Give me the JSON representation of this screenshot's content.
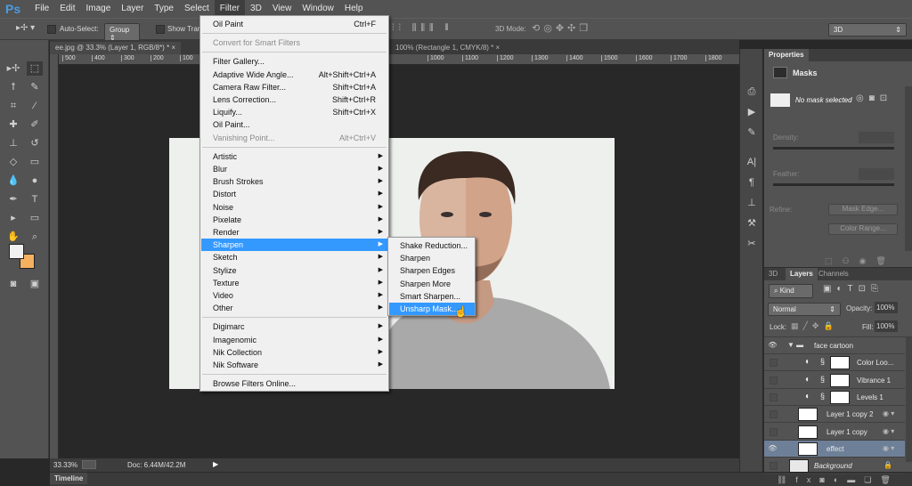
{
  "app": {
    "logo": "Ps"
  },
  "menubar": [
    "File",
    "Edit",
    "Image",
    "Layer",
    "Type",
    "Select",
    "Filter",
    "3D",
    "View",
    "Window",
    "Help"
  ],
  "options": {
    "auto_select": "Auto-Select:",
    "group": "Group",
    "show_transform": "Show Tran",
    "mode_label": "3D Mode:",
    "workspace": "3D"
  },
  "tabs": [
    {
      "label": "ee.jpg @ 33.3% (Layer 1, RGB/8*) *",
      "close": "×"
    },
    {
      "label": "100% (Rectangle 1, CMYK/8) *",
      "close": "×"
    }
  ],
  "ruler": [
    "500",
    "400",
    "300",
    "200",
    "100",
    "0",
    "1000",
    "1100",
    "1200",
    "1300",
    "1400",
    "1500",
    "1600",
    "1700",
    "1800",
    "1900",
    "2000",
    "2100",
    "2200",
    "2300",
    "2400"
  ],
  "status": {
    "zoom": "33.33%",
    "doc": "Doc: 6.44M/42.2M"
  },
  "timeline": "Timeline",
  "filter_menu": [
    {
      "label": "Oil Paint",
      "shortcut": "Ctrl+F"
    },
    {
      "sep": true
    },
    {
      "label": "Convert for Smart Filters",
      "disabled": true
    },
    {
      "sep": true
    },
    {
      "label": "Filter Gallery..."
    },
    {
      "label": "Adaptive Wide Angle...",
      "shortcut": "Alt+Shift+Ctrl+A"
    },
    {
      "label": "Camera Raw Filter...",
      "shortcut": "Shift+Ctrl+A"
    },
    {
      "label": "Lens Correction...",
      "shortcut": "Shift+Ctrl+R"
    },
    {
      "label": "Liquify...",
      "shortcut": "Shift+Ctrl+X"
    },
    {
      "label": "Oil Paint..."
    },
    {
      "label": "Vanishing Point...",
      "shortcut": "Alt+Ctrl+V",
      "disabled": true
    },
    {
      "sep": true
    },
    {
      "label": "Artistic",
      "sub": true
    },
    {
      "label": "Blur",
      "sub": true
    },
    {
      "label": "Brush Strokes",
      "sub": true
    },
    {
      "label": "Distort",
      "sub": true
    },
    {
      "label": "Noise",
      "sub": true
    },
    {
      "label": "Pixelate",
      "sub": true
    },
    {
      "label": "Render",
      "sub": true
    },
    {
      "label": "Sharpen",
      "sub": true,
      "highlighted": true
    },
    {
      "label": "Sketch",
      "sub": true
    },
    {
      "label": "Stylize",
      "sub": true
    },
    {
      "label": "Texture",
      "sub": true
    },
    {
      "label": "Video",
      "sub": true
    },
    {
      "label": "Other",
      "sub": true
    },
    {
      "sep": true
    },
    {
      "label": "Digimarc",
      "sub": true
    },
    {
      "label": "Imagenomic",
      "sub": true
    },
    {
      "label": "Nik Collection",
      "sub": true
    },
    {
      "label": "Nik Software",
      "sub": true
    },
    {
      "sep": true
    },
    {
      "label": "Browse Filters Online..."
    }
  ],
  "sharpen_menu": [
    {
      "label": "Shake Reduction..."
    },
    {
      "label": "Sharpen"
    },
    {
      "label": "Sharpen Edges"
    },
    {
      "label": "Sharpen More"
    },
    {
      "label": "Smart Sharpen..."
    },
    {
      "label": "Unsharp Mask...",
      "highlighted": true
    }
  ],
  "properties": {
    "tab": "Properties",
    "section": "Masks",
    "no_mask": "No mask selected",
    "density": "Density:",
    "feather": "Feather:",
    "refine": "Refine:",
    "mask_edge": "Mask Edge...",
    "color_range": "Color Range..."
  },
  "layers_panel": {
    "tabs": [
      "3D",
      "Layers",
      "Channels"
    ],
    "kind": "Kind",
    "blend": "Normal",
    "opacity_label": "Opacity:",
    "opacity": "100%",
    "lock_label": "Lock:",
    "fill_label": "Fill:",
    "fill": "100%",
    "layers": [
      {
        "name": "face cartoon",
        "type": "group",
        "visible": true
      },
      {
        "name": "Color Loo...",
        "type": "adjustment",
        "visible": false
      },
      {
        "name": "Vibrance 1",
        "type": "adjustment",
        "visible": false
      },
      {
        "name": "Levels 1",
        "type": "adjustment",
        "visible": false
      },
      {
        "name": "Layer 1 copy 2",
        "type": "smart",
        "visible": false
      },
      {
        "name": "Layer 1 copy",
        "type": "smart",
        "visible": false
      },
      {
        "name": "effect",
        "type": "smart",
        "visible": true,
        "selected": true
      },
      {
        "name": "Background",
        "type": "background",
        "visible": false
      }
    ]
  },
  "colors": {
    "highlight": "#3399ff",
    "selected_layer": "#6e8098",
    "foreground": "#f0f0f0",
    "background": "#f5b060"
  }
}
